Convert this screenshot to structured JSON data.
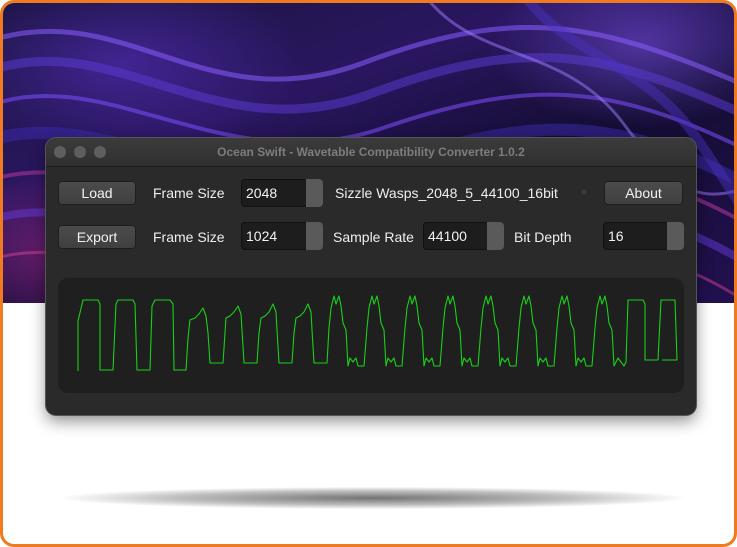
{
  "window": {
    "title": "Ocean Swift - Wavetable Compatibility Converter 1.0.2"
  },
  "row1": {
    "load_label": "Load",
    "frame_size_label": "Frame Size",
    "frame_size_value": "2048",
    "file_name": "Sizzle Wasps_2048_5_44100_16bit",
    "about_label": "About"
  },
  "row2": {
    "export_label": "Export",
    "frame_size_label": "Frame Size",
    "frame_size_value": "1024",
    "sample_rate_label": "Sample Rate",
    "sample_rate_value": "44100",
    "bit_depth_label": "Bit Depth",
    "bit_depth_value": "16"
  },
  "waveform": {
    "color": "#19d019"
  },
  "colors": {
    "frame_border": "#f07a1f",
    "window_bg": "#2a2a2a",
    "scope_bg": "#1f1f1f"
  },
  "icons": [
    "close-traffic-light-icon",
    "minimize-traffic-light-icon",
    "zoom-traffic-light-icon",
    "status-led-icon"
  ]
}
